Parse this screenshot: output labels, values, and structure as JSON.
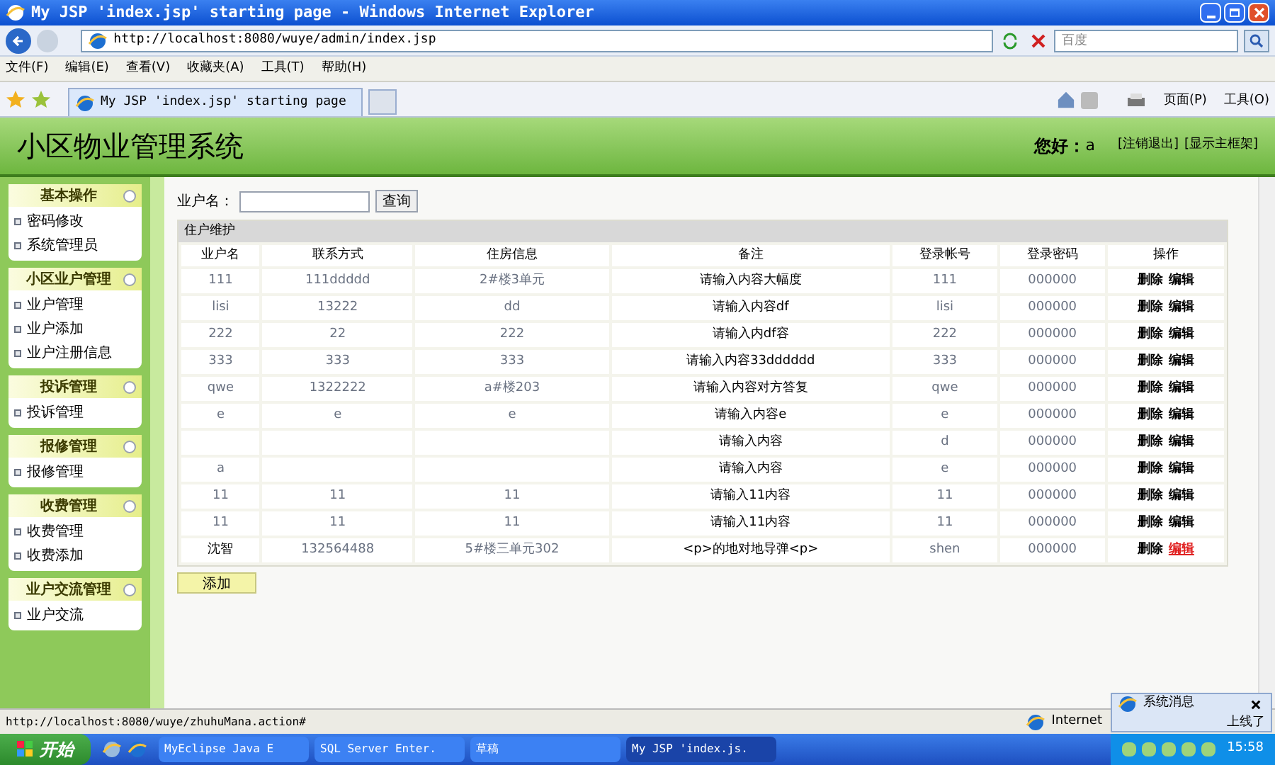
{
  "window": {
    "title": "My JSP 'index.jsp' starting page - Windows Internet Explorer"
  },
  "address_bar": {
    "url": "http://localhost:8080/wuye/admin/index.jsp",
    "search_placeholder": "百度"
  },
  "menu_bar": [
    "文件(F)",
    "编辑(E)",
    "查看(V)",
    "收藏夹(A)",
    "工具(T)",
    "帮助(H)"
  ],
  "browser_tabs": [
    {
      "label": "My JSP 'index.jsp' starting page",
      "selected": true
    }
  ],
  "command_bar": {
    "page": "页面(P)",
    "tools": "工具(O)"
  },
  "header": {
    "title": "小区物业管理系统",
    "greeting": "您好：",
    "user": "a",
    "links": [
      "[注销退出]",
      "[显示主框架]"
    ]
  },
  "sidebar": [
    {
      "title": "基本操作",
      "items": [
        "密码修改",
        "系统管理员"
      ]
    },
    {
      "title": "小区业户管理",
      "items": [
        "业户管理",
        "业户添加",
        "业户注册信息"
      ]
    },
    {
      "title": "投诉管理",
      "items": [
        "投诉管理"
      ]
    },
    {
      "title": "报修管理",
      "items": [
        "报修管理"
      ]
    },
    {
      "title": "收费管理",
      "items": [
        "收费管理",
        "收费添加"
      ]
    },
    {
      "title": "业户交流管理",
      "items": [
        "业户交流"
      ]
    }
  ],
  "search": {
    "label": "业户名：",
    "button": "查询"
  },
  "table": {
    "title": "住户维护",
    "columns": [
      "业户名",
      "联系方式",
      "住房信息",
      "备注",
      "登录帐号",
      "登录密码",
      "操作"
    ],
    "rows": [
      {
        "cells": [
          "111",
          "111ddddd",
          "2#楼3单元",
          "请输入内容大幅度",
          "111",
          "000000"
        ],
        "actions": [
          "删除",
          "编辑"
        ],
        "edit_hovered": false
      },
      {
        "cells": [
          "lisi",
          "13222",
          "dd",
          "请输入内容df",
          "lisi",
          "000000"
        ],
        "actions": [
          "删除",
          "编辑"
        ],
        "edit_hovered": false
      },
      {
        "cells": [
          "222",
          "22",
          "222",
          "请输入内df容",
          "222",
          "000000"
        ],
        "actions": [
          "删除",
          "编辑"
        ],
        "edit_hovered": false
      },
      {
        "cells": [
          "333",
          "333",
          "333",
          "请输入内容33dddddd",
          "333",
          "000000"
        ],
        "actions": [
          "删除",
          "编辑"
        ],
        "edit_hovered": false
      },
      {
        "cells": [
          "qwe",
          "1322222",
          "a#楼203",
          "请输入内容对方答复",
          "qwe",
          "000000"
        ],
        "actions": [
          "删除",
          "编辑"
        ],
        "edit_hovered": false
      },
      {
        "cells": [
          "e",
          "e",
          "e",
          "请输入内容e",
          "e",
          "000000"
        ],
        "actions": [
          "删除",
          "编辑"
        ],
        "edit_hovered": false
      },
      {
        "cells": [
          "",
          "",
          "",
          "请输入内容",
          "d",
          "000000"
        ],
        "actions": [
          "删除",
          "编辑"
        ],
        "edit_hovered": false
      },
      {
        "cells": [
          "a",
          "",
          "",
          "请输入内容",
          "e",
          "000000"
        ],
        "actions": [
          "删除",
          "编辑"
        ],
        "edit_hovered": false
      },
      {
        "cells": [
          "11",
          "11",
          "11",
          "请输入11内容",
          "11",
          "000000"
        ],
        "actions": [
          "删除",
          "编辑"
        ],
        "edit_hovered": false
      },
      {
        "cells": [
          "11",
          "11",
          "11",
          "请输入11内容",
          "11",
          "000000"
        ],
        "actions": [
          "删除",
          "编辑"
        ],
        "edit_hovered": false
      },
      {
        "cells": [
          "沈智",
          "132564488",
          "5#楼三单元302",
          "<p>的地对地导弹<p>",
          "shen",
          "000000"
        ],
        "actions": [
          "删除",
          "编辑"
        ],
        "edit_hovered": true
      }
    ]
  },
  "add_button": "添加",
  "status_bar": {
    "url": "http://localhost:8080/wuye/zhuhuMana.action#",
    "zone": "Internet"
  },
  "notification": {
    "title": "系统消息",
    "text": "上线了"
  },
  "taskbar": {
    "start": "开始",
    "items": [
      {
        "label": "MyEclipse Java E",
        "selected": false
      },
      {
        "label": "SQL Server Enter.",
        "selected": false
      },
      {
        "label": "草稿",
        "selected": false
      },
      {
        "label": "My JSP 'index.js.",
        "selected": true
      }
    ],
    "clock": "15:58"
  }
}
